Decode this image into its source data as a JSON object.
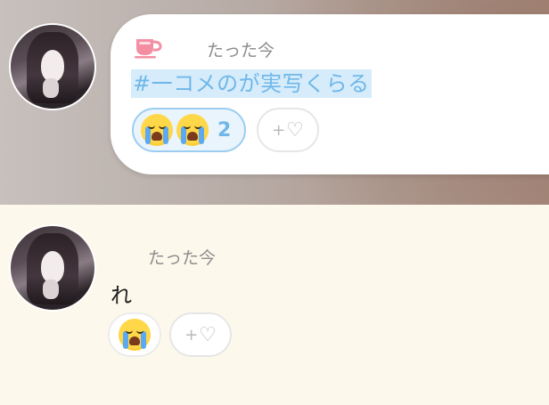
{
  "colors": {
    "hashtag_bg": "#d6ecfb",
    "hashtag_text": "#6fb7e8",
    "reaction_active_border": "#9ccdf0",
    "bottom_bg": "#fdf8ec"
  },
  "post_top": {
    "icon": "cup-icon",
    "timestamp": "たった今",
    "text": "#一コメのが実写くらる",
    "reactions": [
      {
        "emoji": "😭",
        "count": "2",
        "active": true
      }
    ],
    "add_reaction_label": "+"
  },
  "post_bottom": {
    "timestamp": "たった今",
    "text": "れ",
    "reactions": [
      {
        "emoji": "😭",
        "count": "",
        "active": false
      }
    ],
    "add_reaction_label": "+"
  }
}
